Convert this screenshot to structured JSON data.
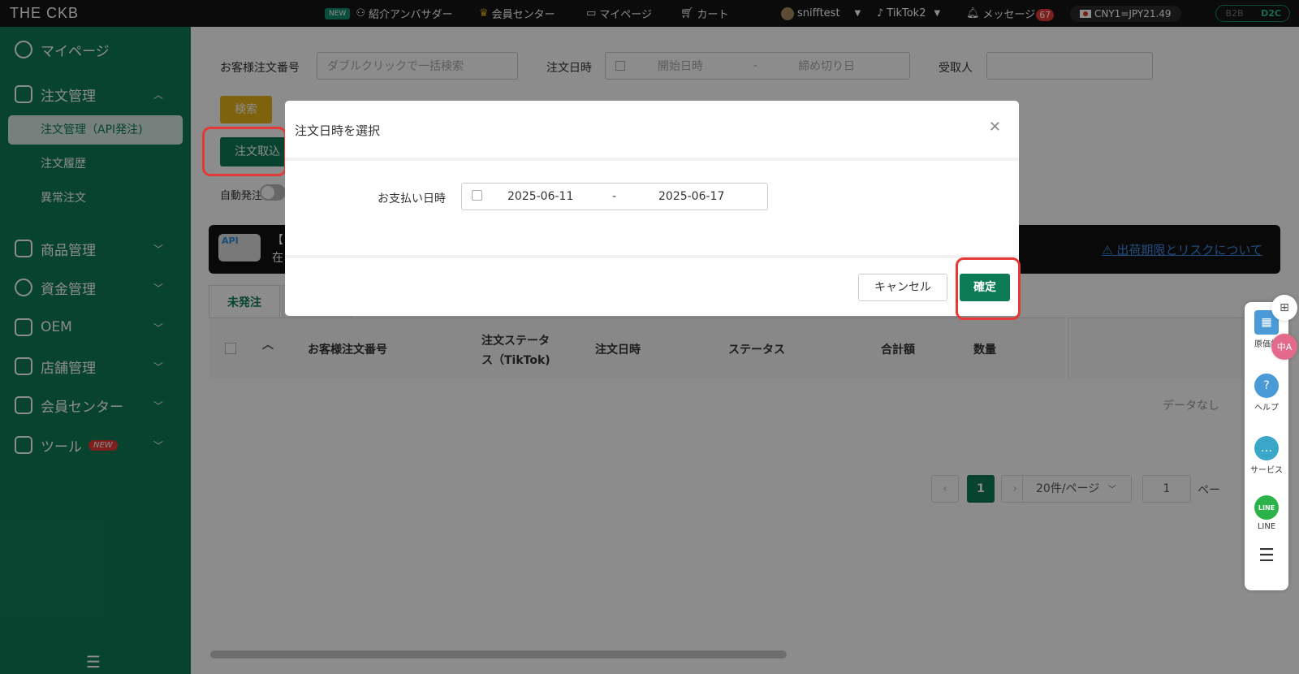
{
  "topbar": {
    "logo": "THE CKB",
    "new_pill": "NEW",
    "ambassador": "紹介アンバサダー",
    "member_center": "会員センター",
    "my_page": "マイページ",
    "cart": "カート",
    "user": "snifftest",
    "store": "TikTok2",
    "messages": "メッセージ",
    "message_count": "67",
    "rate": "CNY1=JPY21.49",
    "mode_b2b": "B2B",
    "mode_d2c": "D2C"
  },
  "sidebar": {
    "my_page": "マイページ",
    "order_mgmt": "注文管理",
    "sub_api_orders": "注文管理（API発注)",
    "sub_history": "注文履歴",
    "sub_abnormal": "異常注文",
    "product_mgmt": "商品管理",
    "fund_mgmt": "資金管理",
    "oem": "OEM",
    "store_mgmt": "店舗管理",
    "member_center": "会員センター",
    "tools": "ツール",
    "tools_tag": "NEW"
  },
  "filters": {
    "order_no_label": "お客様注文番号",
    "order_no_placeholder": "ダブルクリックで一括検索",
    "order_date_label": "注文日時",
    "start_placeholder": "開始日時",
    "date_sep": "-",
    "end_placeholder": "締め切り日",
    "recipient_label": "受取人",
    "search_btn": "検索",
    "import_btn": "注文取込",
    "auto_order_label": "自動発注"
  },
  "banner": {
    "badge": "API",
    "text_line1": "【",
    "text_line2": "在",
    "link": "⚠ 出荷期限とリスクについて"
  },
  "tabs": {
    "unordered": "未発注"
  },
  "table": {
    "headers": [
      "お客様注文番号",
      "注文ステータス（TikTok)",
      "注文日時",
      "ステータス",
      "合計額",
      "数量"
    ],
    "status_line1": "注文ステータ",
    "status_line2": "ス（TikTok)",
    "empty": "データなし"
  },
  "pagination": {
    "prev": "‹",
    "current": "1",
    "next": "›",
    "page_size": "20件/ページ",
    "goto_value": "1",
    "suffix": "ペー"
  },
  "rail": {
    "price_label": "原価計",
    "help_label": "ヘルプ",
    "service_label": "サービス",
    "line_label": "LINE",
    "line_icon_text": "LINE",
    "translate_icon_text": "中A"
  },
  "modal": {
    "title": "注文日時を選択",
    "pay_label": "お支払い日時",
    "start_date": "2025-06-11",
    "sep": "-",
    "end_date": "2025-06-17",
    "cancel": "キャンセル",
    "confirm": "確定"
  },
  "colors": {
    "brand_green": "#0e7b57",
    "search_yellow": "#e8b21a",
    "highlight_red": "#e53935",
    "link_blue": "#3d8be8"
  }
}
